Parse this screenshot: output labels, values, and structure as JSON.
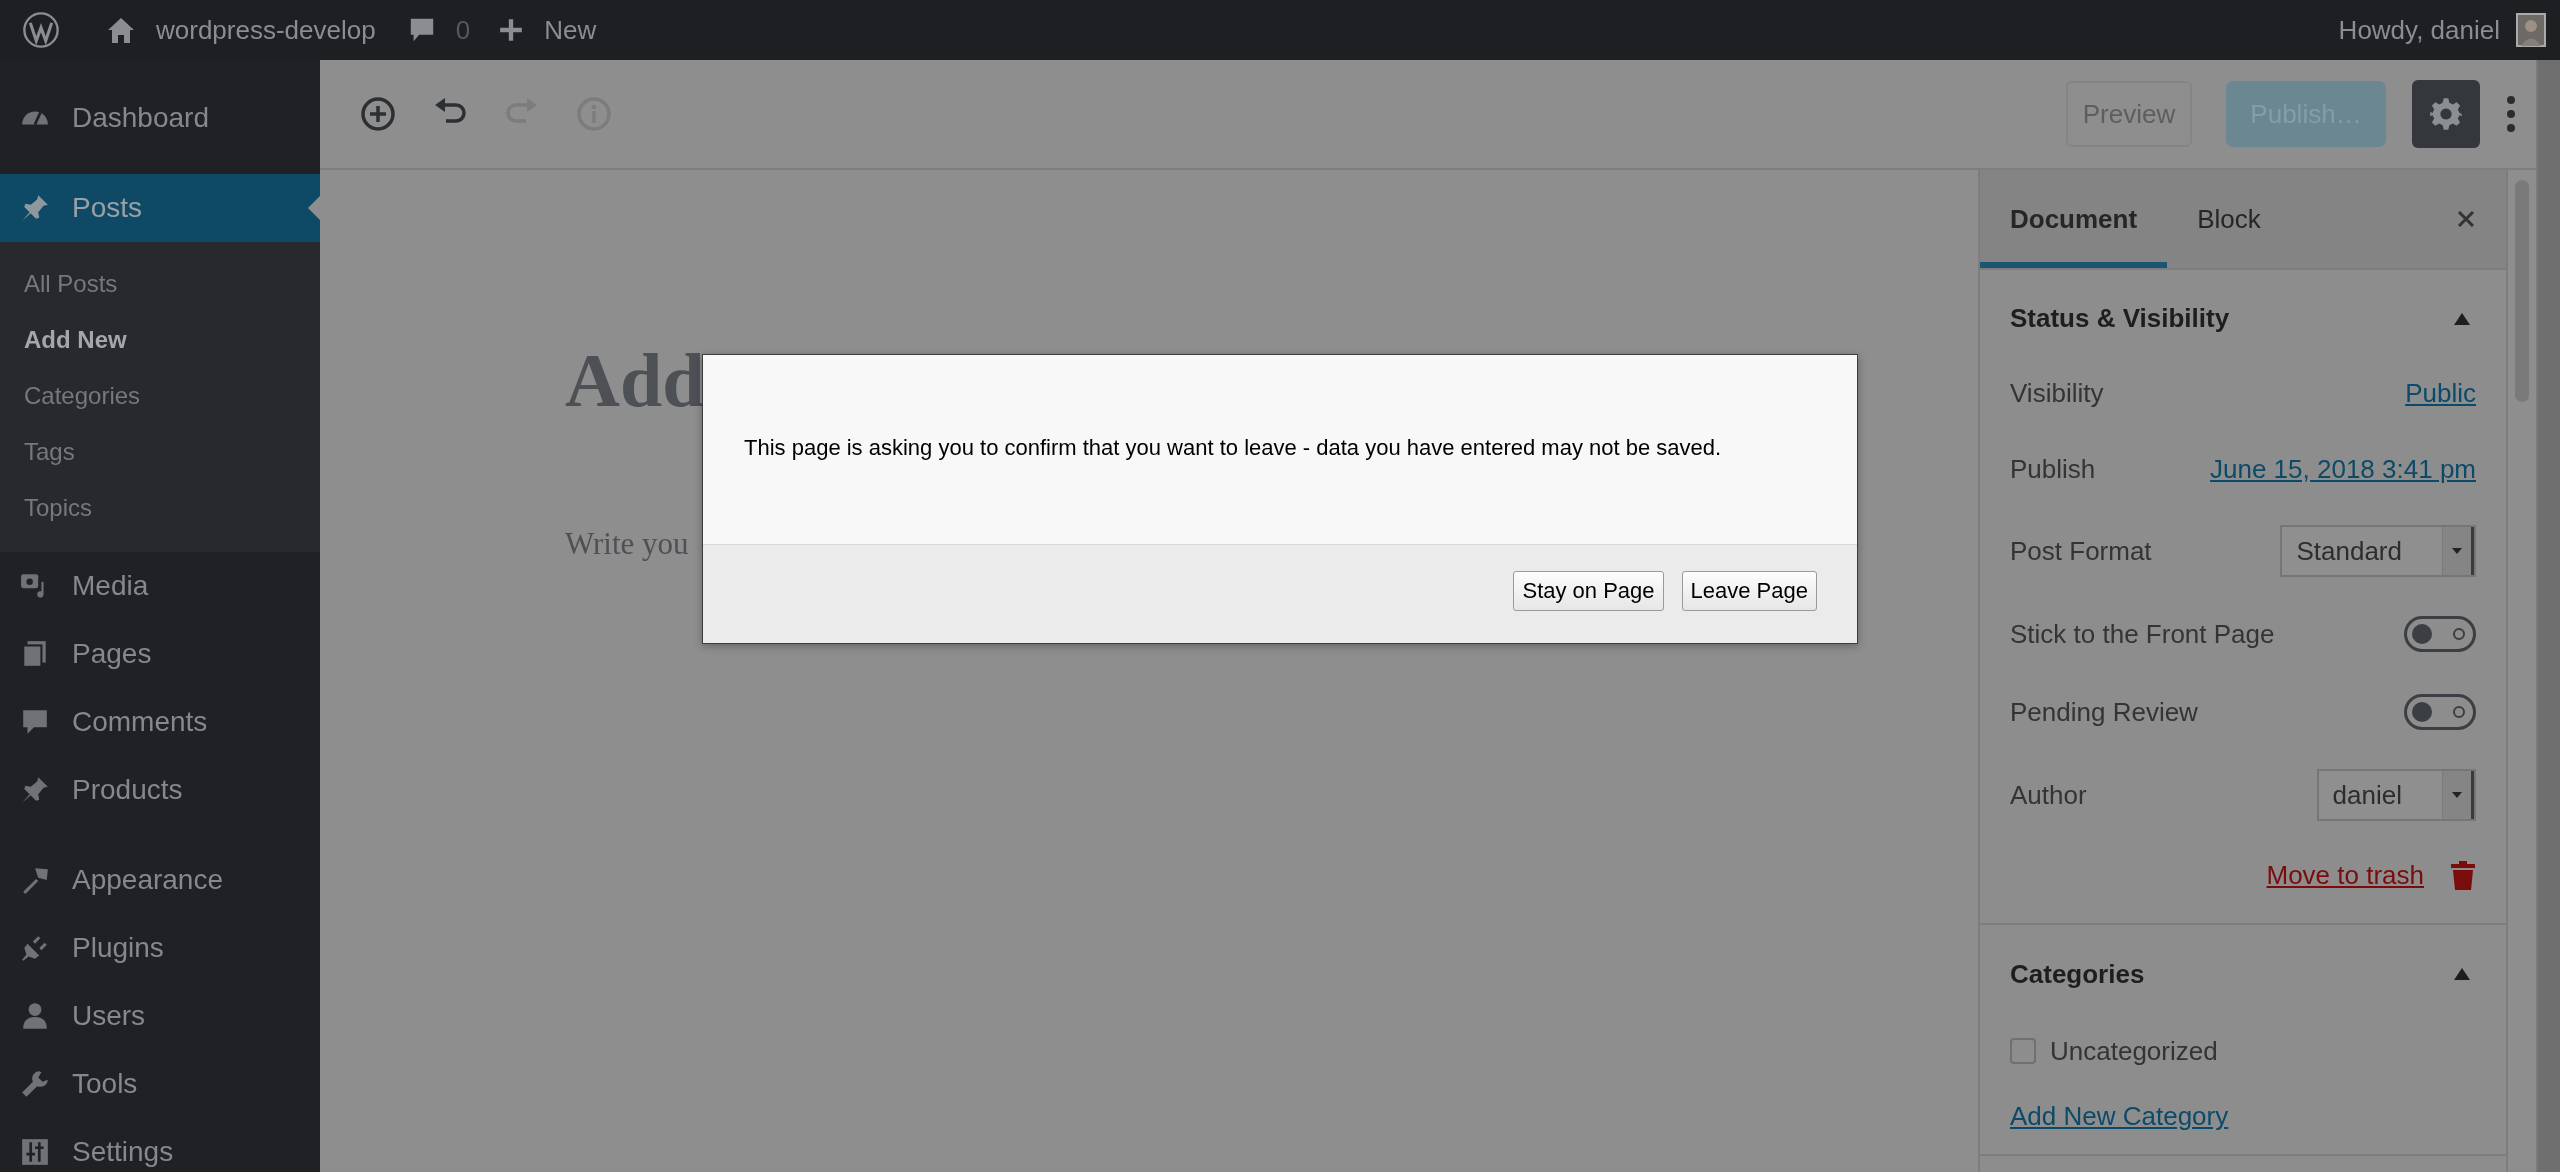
{
  "admin_bar": {
    "site": "wordpress-develop",
    "comments": "0",
    "new": "New",
    "greeting": "Howdy, daniel"
  },
  "menu": [
    {
      "label": "Dashboard",
      "selected": false
    },
    {
      "label": "Posts",
      "selected": true,
      "children": [
        {
          "label": "All Posts",
          "selected": false
        },
        {
          "label": "Add New",
          "selected": true
        },
        {
          "label": "Categories",
          "selected": false
        },
        {
          "label": "Tags",
          "selected": false
        },
        {
          "label": "Topics",
          "selected": false
        }
      ]
    },
    {
      "label": "Media",
      "selected": false
    },
    {
      "label": "Pages",
      "selected": false
    },
    {
      "label": "Comments",
      "selected": false
    },
    {
      "label": "Products",
      "selected": false
    },
    {
      "label": "Appearance",
      "selected": false
    },
    {
      "label": "Plugins",
      "selected": false
    },
    {
      "label": "Users",
      "selected": false
    },
    {
      "label": "Tools",
      "selected": false
    },
    {
      "label": "Settings",
      "selected": false
    }
  ],
  "toolbar": {
    "tools": [
      {
        "kind": "inserter",
        "disabled": false
      },
      {
        "kind": "undo",
        "disabled": false
      },
      {
        "kind": "redo",
        "disabled": true
      },
      {
        "kind": "info",
        "disabled": true
      }
    ],
    "preview": "Preview",
    "publish": "Publish…",
    "settings_on": true
  },
  "editor": {
    "title": "Add",
    "body": "Write you"
  },
  "sidebar": {
    "tabs": [
      {
        "label": "Document",
        "selected": true
      },
      {
        "label": "Block",
        "selected": false
      }
    ],
    "status": {
      "title": "Status & Visibility",
      "expanded": true,
      "rows": [
        {
          "kind": "link",
          "label": "Visibility",
          "value": "Public"
        },
        {
          "kind": "link",
          "label": "Publish",
          "value": "June 15, 2018 3:41 pm"
        },
        {
          "kind": "select",
          "label": "Post Format",
          "value": "Standard"
        },
        {
          "kind": "toggle",
          "label": "Stick to the Front Page",
          "on": false
        },
        {
          "kind": "toggle",
          "label": "Pending Review",
          "on": false
        },
        {
          "kind": "select",
          "label": "Author",
          "value": "daniel"
        }
      ],
      "trash": "Move to trash"
    },
    "categories": {
      "title": "Categories",
      "expanded": true,
      "items": [
        {
          "label": "Uncategorized",
          "checked": false
        }
      ],
      "add_link": "Add New Category"
    }
  },
  "dialog": {
    "message": "This page is asking you to confirm that you want to leave - data you have entered may not be saved.",
    "buttons": [
      "Stay on Page",
      "Leave Page"
    ]
  }
}
